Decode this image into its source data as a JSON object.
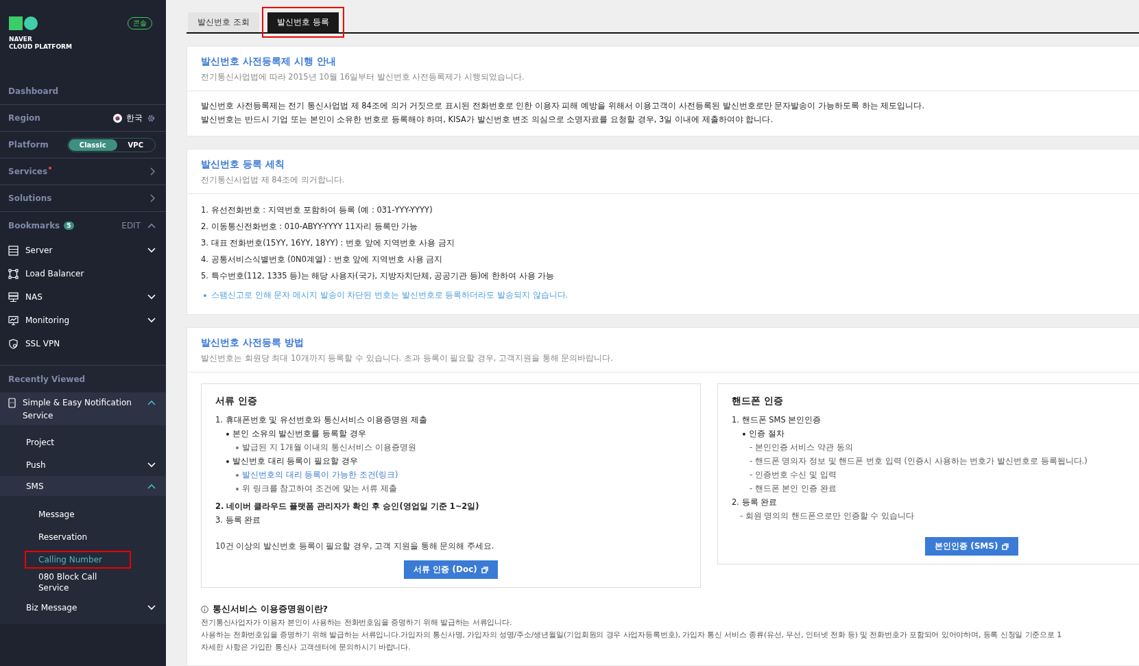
{
  "sidebar": {
    "logo": {
      "line1": "NAVER",
      "line2": "CLOUD PLATFORM"
    },
    "console_badge": "콘솔",
    "dashboard": "Dashboard",
    "region": {
      "label": "Region",
      "value": "한국"
    },
    "platform": {
      "label": "Platform",
      "options": [
        {
          "label": "Classic",
          "selected": true
        },
        {
          "label": "VPC",
          "selected": false
        }
      ]
    },
    "menus": [
      {
        "label": "Services",
        "new": true
      },
      {
        "label": "Solutions",
        "new": false
      }
    ],
    "bookmarks": {
      "label": "Bookmarks",
      "count": "5",
      "edit": "EDIT",
      "expanded": true,
      "items": [
        {
          "label": "Server",
          "kind": "server",
          "expanded": false
        },
        {
          "label": "Load Balancer",
          "kind": "balancer"
        },
        {
          "label": "NAS",
          "kind": "nas",
          "expanded": false
        },
        {
          "label": "Monitoring",
          "kind": "monitor",
          "expanded": false
        },
        {
          "label": "SSL VPN",
          "kind": "vpn"
        }
      ]
    },
    "recently_viewed": {
      "label": "Recently Viewed",
      "items": [
        {
          "label": "Simple & Easy Notification Service",
          "expanded": true,
          "children": [
            {
              "label": "Project",
              "selected": false
            },
            {
              "label": "Push",
              "selected": false,
              "expanded": false
            },
            {
              "label": "SMS",
              "selected": false,
              "expanded": true,
              "children": [
                {
                  "label": "Message",
                  "selected": false,
                  "highlighted": false
                },
                {
                  "label": "Reservation",
                  "selected": false,
                  "highlighted": false
                },
                {
                  "label": "Calling Number",
                  "selected": true,
                  "highlighted": true
                },
                {
                  "label": "080 Block Call Service",
                  "selected": false,
                  "highlighted": false
                }
              ]
            },
            {
              "label": "Biz Message",
              "selected": false,
              "expanded": false
            }
          ]
        }
      ]
    }
  },
  "tabs": [
    {
      "label": "발신번호 조회",
      "selected": false,
      "highlighted": false
    },
    {
      "label": "발신번호 등록",
      "selected": true,
      "highlighted": true
    }
  ],
  "notice": {
    "title": "발신번호 사전등록제 시행 안내",
    "subtitle": "전기통신사업법에 따라 2015년 10월 16일부터 발신번호 사전등록제가 시행되었습니다.",
    "body": [
      "발신번호 사전등록제는 전기 통신사업법 제 84조에 의거 거짓으로 표시된 전화번호로 인한 이용자 피해 예방을 위해서 이용고객이 사전등록된 발신번호로만 문자발송이 가능하도록 하는 제도입니다.",
      "발신번호는 반드시 기업 또는 본인이 소유한 번호로 등록해야 하며, KISA가 발신번호 변조 의심으로 소명자료를 요청할 경우, 3일 이내에 제출하여야 합니다."
    ]
  },
  "rules": {
    "title": "발신번호 등록 세칙",
    "subtitle": "전기통신사업법 제 84조에 의거합니다.",
    "items": [
      "1. 유선전화번호 : 지역번호 포함하여 등록 (예 : 031-YYY-YYYY)",
      "2. 이동통신전화번호 : 010-ABYY-YYYY 11자리 등록만 가능",
      "3. 대표 전화번호(15YY, 16YY, 18YY) : 번호 앞에 지역번호 사용 금지",
      "4. 공통서비스식별번호 (0N0계열) : 번호 앞에 지역번호 사용 금지",
      "5. 특수번호(112, 1335 등)는 해당 사용자(국가, 지방자치단체, 공공기관 등)에 한하여 사용 가능"
    ],
    "warning": "스팸신고로 인해 문자 메시지 발송이 차단된 번호는 발신번호로 등록하더라도 발송되지 않습니다."
  },
  "method": {
    "title": "발신번호 사전등록 방법",
    "subtitle": "발신번호는 회원당 최대 10개까지 등록할 수 있습니다. 초과 등록이 필요할 경우, 고객지원을 통해 문의바랍니다.",
    "boxes": [
      {
        "title": "서류 인증",
        "button": "서류 인증 (Doc)",
        "lines": [
          {
            "kind": "step",
            "text": "1. 휴대폰번호 및 유선번호와 통신서비스 이용증명원 제출"
          },
          {
            "kind": "bullet",
            "text": "본인 소유의 발신번호를 등록할 경우"
          },
          {
            "kind": "sub",
            "text": "발급된 지 1개월 이내의 통신서비스 이용증명원"
          },
          {
            "kind": "bullet",
            "text": "발신번호 대리 등록이 필요할 경우"
          },
          {
            "kind": "link",
            "text": "발신번호의 대리 등록이 가능한 조건(링크)"
          },
          {
            "kind": "sub",
            "text": "위 링크를 참고하여 조건에 맞는 서류 제출"
          },
          {
            "kind": "strong",
            "text": "2. 네이버 클라우드 플랫폼 관리자가 확인 후 승인(영업일 기준 1~2일)"
          },
          {
            "kind": "step",
            "text": "3. 등록 완료"
          },
          {
            "kind": "note",
            "text": "10건 이상의 발신번호 등록이 필요할 경우, 고객 지원을 통해 문의해 주세요."
          }
        ]
      },
      {
        "title": "핸드폰 인증",
        "button": "본인인증 (SMS)",
        "lines": [
          {
            "kind": "step",
            "text": "1. 핸드폰 SMS 본인인증"
          },
          {
            "kind": "bullet",
            "text": "인증 절차"
          },
          {
            "kind": "dash",
            "text": "- 본인인증 서비스 약관 동의"
          },
          {
            "kind": "dash",
            "text": "- 핸드폰 명의자 정보 및 핸드폰 번호 입력 (인증시 사용하는 번호가 발신번호로 등록됩니다.)"
          },
          {
            "kind": "dash",
            "text": "- 인증번호 수신 및 입력"
          },
          {
            "kind": "dash",
            "text": "- 핸드폰 본인 인증 완료"
          },
          {
            "kind": "step",
            "text": "2. 등록 완료"
          },
          {
            "kind": "remark",
            "text": "- 회원 명의의 핸드폰으로만 인증할 수 있습니다"
          }
        ]
      }
    ],
    "info": {
      "title": "통신서비스 이용증명원이란?",
      "lines": [
        "전기통신사업자가 이용자 본인이 사용하는 전화번호임을 증명하기 위해 발급하는 서류입니다.",
        "사용하는 전화번호임을 증명하기 위해 발급하는 서류입니다.가입자의 통신사명, 가입자의 성명/주소/생년월일(기업회원의 경우 사업자등록번호), 가입자 통신 서비스 종류(유선, 무선, 인터넷 전화 등) 및 전화번호가 포함되어 있어야하며, 등록 신청일 기준으로 1",
        "자세한 사항은 가입한 통신사 고객센터에 문의하시기 바랍니다."
      ]
    }
  }
}
